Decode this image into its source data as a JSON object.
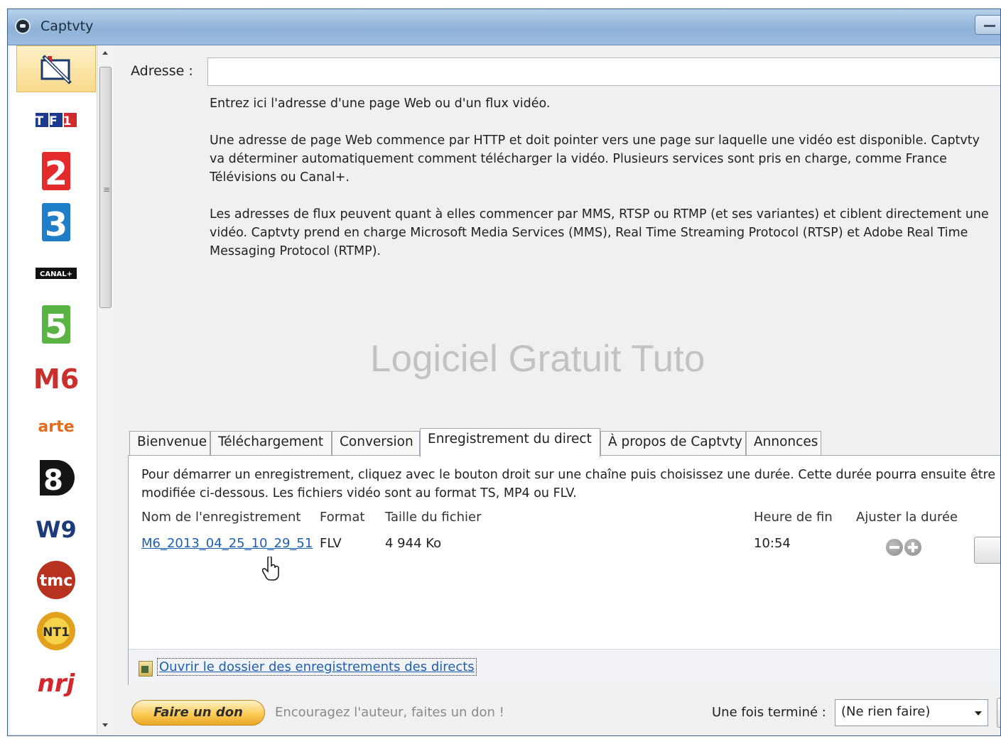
{
  "window": {
    "title": "Captvty"
  },
  "address": {
    "label": "Adresse :",
    "value": "",
    "help": [
      "Entrez ici l'adresse d'une page Web ou d'un flux vidéo.",
      "Une adresse de page Web commence par HTTP et doit pointer vers une page sur laquelle une vidéo est disponible. Captvty va déterminer automatiquement comment télécharger la vidéo. Plusieurs services sont pris en charge, comme France Télévisions ou Canal+.",
      "Les adresses de flux peuvent quant à elles commencer par MMS, RTSP ou RTMP (et ses variantes) et ciblent directement une vidéo. Captvty prend en charge Microsoft Media Services (MMS), Real Time Streaming Protocol (RTSP) et Adobe Real Time Messaging Protocol (RTMP)."
    ]
  },
  "watermark": "Logiciel Gratuit Tuto",
  "channels": [
    {
      "name": "url-tool-icon",
      "text": ""
    },
    {
      "name": "tf1-logo",
      "text": "TF1"
    },
    {
      "name": "france2-logo",
      "text": "2"
    },
    {
      "name": "france3-logo",
      "text": "3"
    },
    {
      "name": "canalplus-logo",
      "text": "CANAL+"
    },
    {
      "name": "france5-logo",
      "text": "5"
    },
    {
      "name": "m6-logo",
      "text": "M6"
    },
    {
      "name": "arte-logo",
      "text": "arte"
    },
    {
      "name": "d8-logo",
      "text": "8"
    },
    {
      "name": "w9-logo",
      "text": "W9"
    },
    {
      "name": "tmc-logo",
      "text": "tmc"
    },
    {
      "name": "nt1-logo",
      "text": "NT1"
    },
    {
      "name": "nrj12-logo",
      "text": "nrj"
    }
  ],
  "tabs": [
    {
      "label": "Bienvenue"
    },
    {
      "label": "Téléchargement"
    },
    {
      "label": "Conversion"
    },
    {
      "label": "Enregistrement du direct",
      "active": true
    },
    {
      "label": "À propos de Captvty"
    },
    {
      "label": "Annonces"
    }
  ],
  "recording": {
    "description": "Pour démarrer un enregistrement, cliquez avec le bouton droit sur une chaîne puis choisissez une durée. Cette durée pourra ensuite être modifiée ci-dessous. Les fichiers vidéo sont au format TS, MP4 ou FLV.",
    "columns": {
      "name": "Nom de l'enregistrement",
      "format": "Format",
      "size": "Taille du fichier",
      "end": "Heure de fin",
      "adjust": "Ajuster la durée"
    },
    "rows": [
      {
        "name": "M6_2013_04_25_10_29_51",
        "format": "FLV",
        "size": "4 944 Ko",
        "end": "10:54"
      }
    ],
    "open_folder": "Ouvrir le dossier des enregistrements des directs"
  },
  "footer": {
    "donate_button": "Faire un don",
    "donate_text": "Encouragez l'auteur, faites un don !",
    "when_done_label": "Une fois terminé :",
    "when_done_value": "(Ne rien faire)"
  }
}
